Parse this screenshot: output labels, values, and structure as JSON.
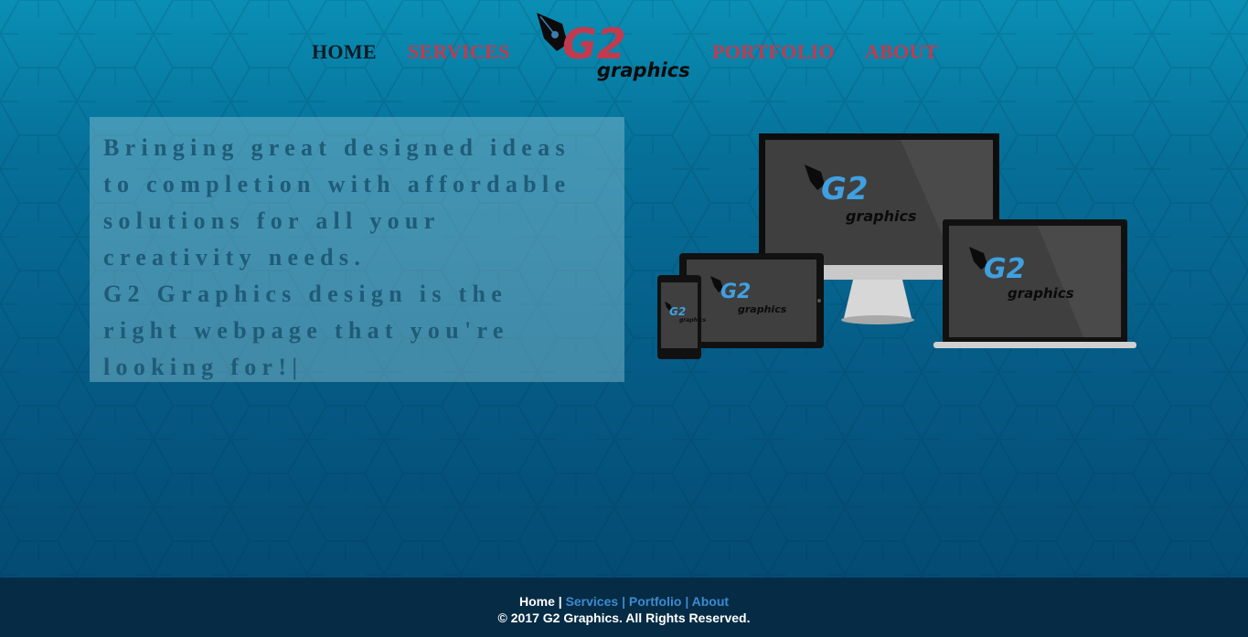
{
  "nav": {
    "home": "HOME",
    "services": "SERVICES",
    "portfolio": "PORTFOLIO",
    "about": "ABOUT"
  },
  "brand": {
    "mark": "G2",
    "word": "graphics"
  },
  "hero": {
    "lines": [
      "Bringing great designed ideas",
      "to completion with affordable",
      "solutions for all your",
      "creativity needs.",
      "G2 Graphics design is the",
      "right webpage that you're",
      "looking for!|"
    ]
  },
  "footer": {
    "home": "Home",
    "sep": "|",
    "services": "Services",
    "portfolio": "Portfolio",
    "about": "About",
    "copyright": "© 2017 G2 Graphics. All Rights Reserved."
  },
  "colors": {
    "nav_active": "#0d1c24",
    "nav_link": "#c23a4e",
    "footer_bg": "#062b45",
    "footer_link": "#3c8bd0",
    "hero_text": "#1f5b77"
  }
}
